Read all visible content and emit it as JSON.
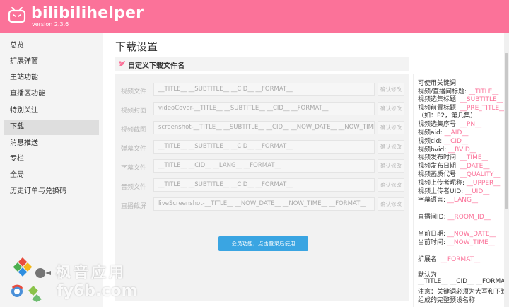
{
  "app": {
    "title": "bilibilihelper",
    "version": "version 2.3.6"
  },
  "sidebar": {
    "items": [
      {
        "label": "总览"
      },
      {
        "label": "扩展弹窗"
      },
      {
        "label": "主站功能"
      },
      {
        "label": "直播区功能"
      },
      {
        "label": "特别关注"
      },
      {
        "label": "下载",
        "active": true
      },
      {
        "label": "消息推送"
      },
      {
        "label": "专栏"
      },
      {
        "label": "全局"
      },
      {
        "label": "历史订单与兑换码"
      }
    ]
  },
  "main": {
    "title": "下载设置",
    "section_title": "自定义下载文件名",
    "rows": [
      {
        "label": "视频文件",
        "value": "__TITLE__ __SUBTITLE__ __CID__ __FORMAT__",
        "button": "确认修改"
      },
      {
        "label": "视频封面",
        "value": "videoCover-__TITLE__ __SUBTITLE__ __CID__ __FORMAT__",
        "button": "确认修改"
      },
      {
        "label": "视频截图",
        "value": "screenshot-__TITLE__ __SUBTITLE__ __CID__ __NOW_DATE__ __NOW_TIME__",
        "button": "确认修改"
      },
      {
        "label": "弹幕文件",
        "value": "__TITLE__ __SUBTITLE__ __CID__ __FORMAT__",
        "button": "确认修改"
      },
      {
        "label": "字幕文件",
        "value": "__TITLE__ __CID__ __LANG__ __FORMAT__",
        "button": "确认修改"
      },
      {
        "label": "音频文件",
        "value": "__TITLE__ __SUBTITLE__ __CID__ __FORMAT__",
        "button": "确认修改"
      },
      {
        "label": "直播截屏",
        "value": "liveScreenshot-__TITLE__ __NOW_DATE__ __NOW_TIME__ __FORMAT__",
        "button": "确认修改"
      }
    ],
    "vip_button": "会员功能，点击登录后使用"
  },
  "help": {
    "lines": [
      {
        "text": "可使用关键词:",
        "kw": ""
      },
      {
        "text": "视频/直播间标题:",
        "kw": "__TITLE__"
      },
      {
        "text": "视频选集标题:",
        "kw": "__SUBTITLE__"
      },
      {
        "text": "视频前置标题:",
        "kw": "__PRE_TITLE__"
      },
      {
        "text": "（如：P2，第几集）",
        "kw": ""
      },
      {
        "text": "视频选集序号:",
        "kw": "__PN__"
      },
      {
        "text": "视频aid:",
        "kw": "__AID__"
      },
      {
        "text": "视频cid:",
        "kw": "__CID__"
      },
      {
        "text": "视频bvid:",
        "kw": "__BVID__"
      },
      {
        "text": "视频发布时间:",
        "kw": "__TIME__"
      },
      {
        "text": "视频发布日期:",
        "kw": "__DATE__"
      },
      {
        "text": "视频画质代号:",
        "kw": "__QUALITY__"
      },
      {
        "text": "视频上传者昵称:",
        "kw": "__UPPER__"
      },
      {
        "text": "视频上传者UID:",
        "kw": "__UID__"
      },
      {
        "text": "字幕语言:",
        "kw": "__LANG__"
      },
      {
        "text": "直播间ID:",
        "kw": "__ROOM_ID__"
      },
      {
        "text": "当前日期:",
        "kw": "__NOW_DATE__"
      },
      {
        "text": "当前时间:",
        "kw": "__NOW_TIME__"
      },
      {
        "text": "扩展名:",
        "kw": "__FORMAT__"
      },
      {
        "text": "默认为:",
        "kw": ""
      },
      {
        "text": "__TITLE__ __CID__ __FORMAT__",
        "kw": ""
      },
      {
        "text": "注意：关键词必须为大写和下划线",
        "kw": ""
      },
      {
        "text": "组成的完整预设名称",
        "kw": ""
      }
    ]
  },
  "watermark": {
    "line1": "枫音应用",
    "line2": "fy6b.com"
  },
  "colors": {
    "brand": "#fb7299",
    "button": "#3aa5e2"
  }
}
